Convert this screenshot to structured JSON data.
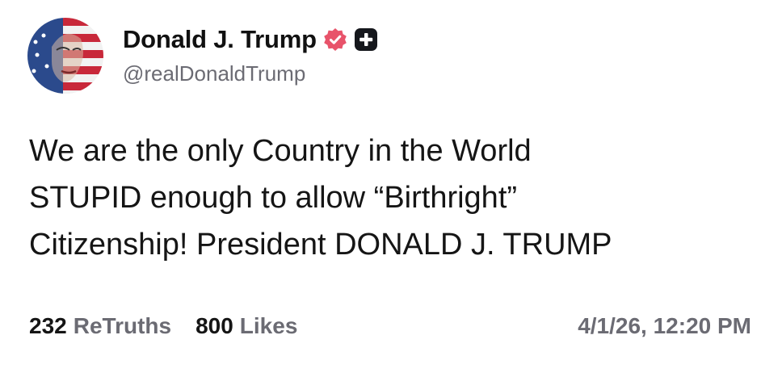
{
  "post": {
    "author": {
      "display_name": "Donald J. Trump",
      "handle": "@realDonaldTrump",
      "verified_badge_icon": "verified-badge-icon",
      "plus_badge_icon": "plus-badge-icon",
      "avatar_icon": "avatar-flag-portrait"
    },
    "body_lines": [
      "We are the only Country in the World",
      "STUPID enough to allow “Birthright”",
      "Citizenship! President DONALD J. TRUMP"
    ],
    "stats": {
      "retruths_count": "232",
      "retruths_label": "ReTruths",
      "likes_count": "800",
      "likes_label": "Likes"
    },
    "timestamp": "4/1/26, 12:20 PM"
  },
  "colors": {
    "text_primary": "#151515",
    "text_secondary": "#6b6b73",
    "verified_badge": "#e8536a",
    "plus_badge": "#15171c"
  }
}
